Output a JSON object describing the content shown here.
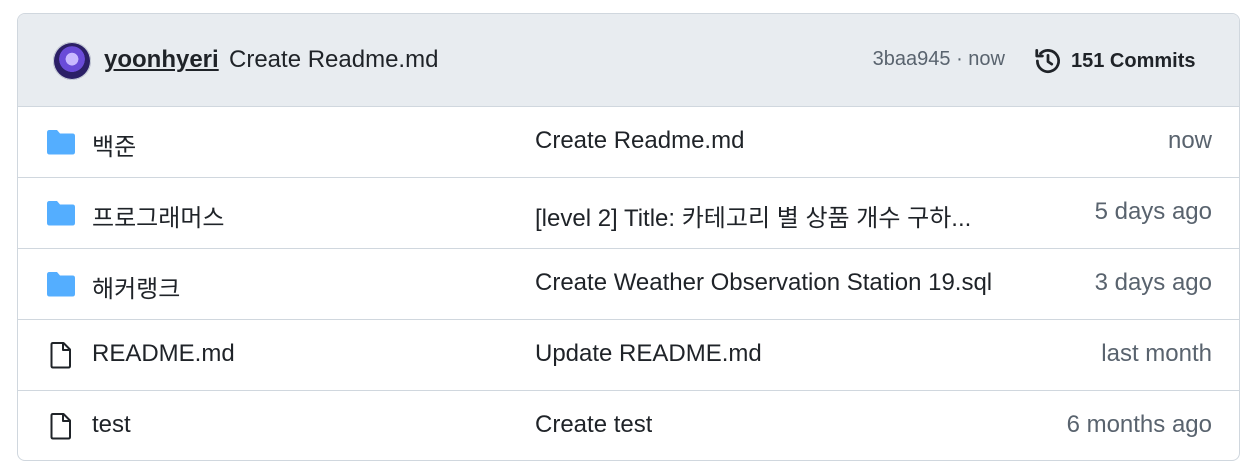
{
  "latest_commit": {
    "author": "yoonhyeri",
    "message": "Create Readme.md",
    "sha_time": "3baa945 · now",
    "commits_label": "151 Commits"
  },
  "files": [
    {
      "type": "folder",
      "name": "백준",
      "message": "Create Readme.md",
      "age": "now"
    },
    {
      "type": "folder",
      "name": "프로그래머스",
      "message": "[level 2] Title: 카테고리 별 상품 개수 구하...",
      "age": "5 days ago"
    },
    {
      "type": "folder",
      "name": "해커랭크",
      "message": "Create Weather Observation Station 19.sql",
      "age": "3 days ago"
    },
    {
      "type": "file",
      "name": "README.md",
      "message": "Update README.md",
      "age": "last month"
    },
    {
      "type": "file",
      "name": "test",
      "message": "Create test",
      "age": "6 months ago"
    }
  ],
  "colors": {
    "folder": "#54aeff",
    "border": "#d0d7de",
    "header_bg": "#e8ecf0",
    "muted": "#59636e"
  },
  "icons": {
    "folder": "folder-icon",
    "file": "file-icon",
    "history": "history-icon"
  }
}
